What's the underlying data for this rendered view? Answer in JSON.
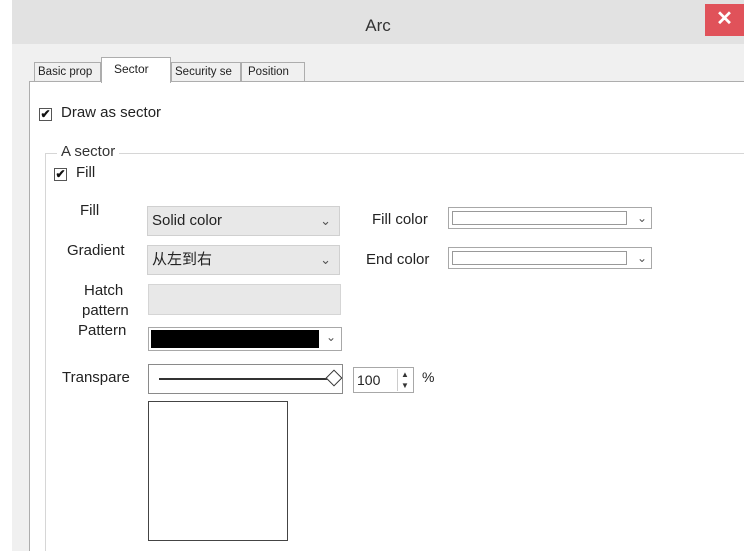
{
  "window": {
    "title": "Arc",
    "close_glyph": "✕"
  },
  "tabs": [
    {
      "label": "Basic prop"
    },
    {
      "label": "Sector"
    },
    {
      "label": "Security se"
    },
    {
      "label": "Position"
    }
  ],
  "draw_as_sector": {
    "label": "Draw as sector",
    "checked": true
  },
  "sector_group": {
    "title": "A sector",
    "fill_checkbox": {
      "label": "Fill",
      "checked": true
    },
    "fill": {
      "label": "Fill",
      "value": "Solid color"
    },
    "fill_color": {
      "label": "Fill color",
      "value": "#ffffff"
    },
    "gradient": {
      "label": "Gradient",
      "value": "从左到右"
    },
    "end_color": {
      "label": "End color",
      "value": "#ffffff"
    },
    "hatch_pattern": {
      "label_line1": "Hatch",
      "label_line2": "pattern"
    },
    "pattern": {
      "label": "Pattern",
      "value": "#000000"
    },
    "transparency": {
      "label": "Transpare",
      "value": "100",
      "unit": "%"
    }
  },
  "icons": {
    "checkmark": "✔",
    "chevron": "⌄",
    "spin_up": "▲",
    "spin_down": "▼"
  }
}
